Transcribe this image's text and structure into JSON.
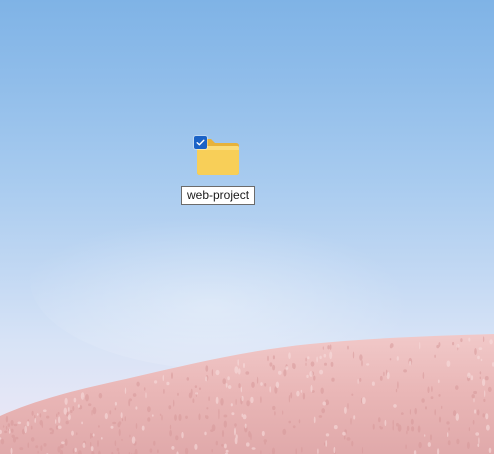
{
  "desktop": {
    "icons": [
      {
        "label": "web-project",
        "icon": "folder-icon",
        "selected": true,
        "renaming": true
      }
    ]
  },
  "colors": {
    "sky_top": "#7fb3e6",
    "sky_bottom": "#ece6f3",
    "hill": "#ecbcbc",
    "folder": "#f6c94f",
    "check_accent": "#1b62c6"
  }
}
